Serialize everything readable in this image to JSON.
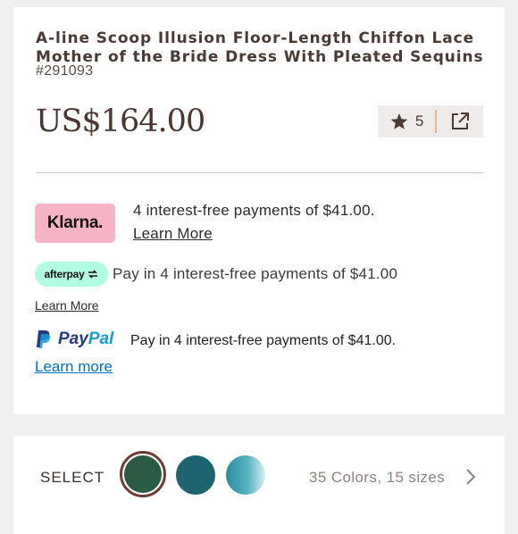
{
  "product": {
    "title": "A-line Scoop Illusion Floor-Length Chiffon Lace Mother of the Bride Dress With Pleated Sequins",
    "sku": "#291093",
    "price": "US$164.00",
    "rating_count": "5"
  },
  "payments": {
    "klarna": {
      "badge": "Klarna.",
      "text": "4 interest-free payments of $41.00.",
      "link": "Learn More",
      "color": "#f7b4c7"
    },
    "afterpay": {
      "badge": "afterpay",
      "text": "Pay in 4 interest-free payments of $41.00",
      "link": "Learn More",
      "color": "#b2fce4"
    },
    "paypal": {
      "logo_part1": "Pay",
      "logo_part2": "Pal",
      "text": "Pay in 4 interest-free payments of $41.00.",
      "link": "Learn more",
      "colors": {
        "dark": "#253b80",
        "light": "#179bd7"
      }
    }
  },
  "select": {
    "label": "SELECT",
    "swatches": [
      {
        "name": "dark green",
        "color": "#2c5b45",
        "selected": true
      },
      {
        "name": "teal",
        "color": "#1d6370",
        "selected": false
      },
      {
        "name": "light blue",
        "color": "#57b2bf",
        "selected": false
      }
    ],
    "summary": "35 Colors, 15 sizes"
  },
  "icons": {
    "rating": "star-icon",
    "share": "share-icon",
    "afterpay": "afterpay-arrows-icon",
    "paypal": "paypal-p-icon",
    "next": "chevron-right-icon"
  }
}
